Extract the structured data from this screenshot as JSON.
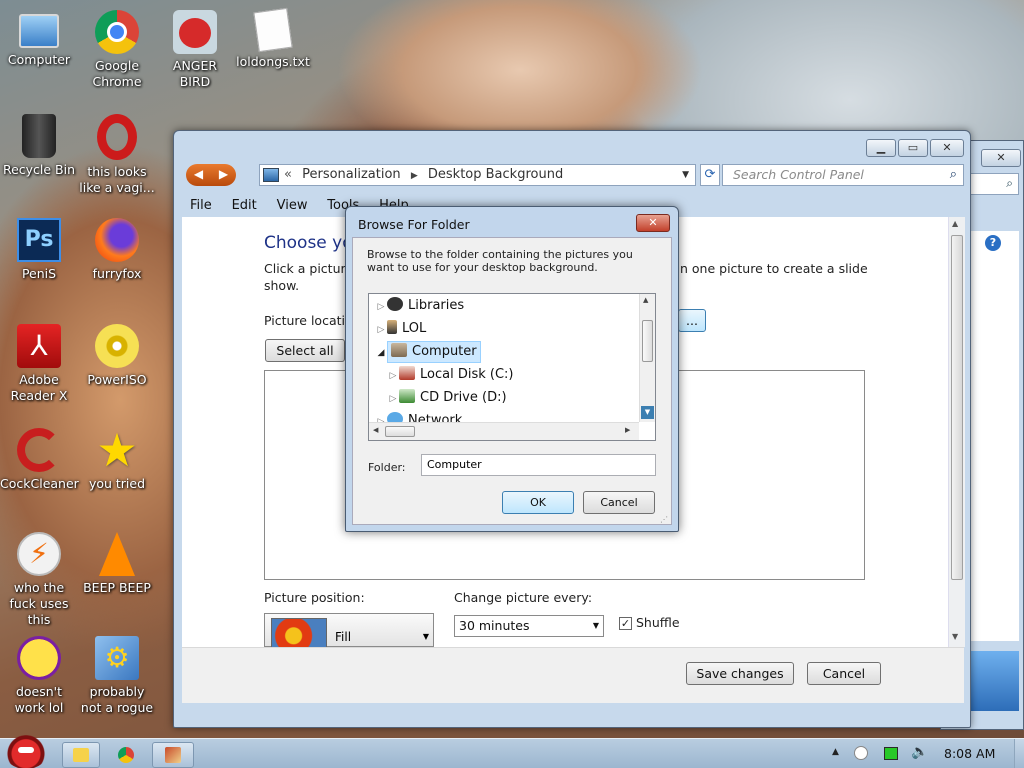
{
  "desktop": {
    "icons": [
      {
        "label": "Computer"
      },
      {
        "label": "Google Chrome"
      },
      {
        "label": "ANGER BIRD"
      },
      {
        "label": "loldongs.txt"
      },
      {
        "label": "Recycle Bin"
      },
      {
        "label": "this looks like a vagi..."
      },
      {
        "label": "PeniS"
      },
      {
        "label": "furryfox"
      },
      {
        "label": "Adobe Reader X"
      },
      {
        "label": "PowerISO"
      },
      {
        "label": "CockCleaner"
      },
      {
        "label": "you tried"
      },
      {
        "label": "who the fuck uses this"
      },
      {
        "label": "BEEP BEEP"
      },
      {
        "label": "doesn't work lol"
      },
      {
        "label": "probably not a rogue"
      }
    ]
  },
  "window": {
    "breadcrumb_prefix": "«",
    "breadcrumb": [
      "Personalization",
      "Desktop Background"
    ],
    "search_placeholder": "Search Control Panel",
    "menu": [
      "File",
      "Edit",
      "View",
      "Tools",
      "Help"
    ],
    "heading": "Choose you",
    "description_left": "Click a picture",
    "description_left2": "show.",
    "description_right": "n one picture to create a slide",
    "picture_location_label": "Picture locatio",
    "browse_button_label": "...",
    "select_all_label": "Select all",
    "picture_position_label": "Picture position:",
    "picture_position_value": "Fill",
    "change_picture_label": "Change picture every:",
    "change_picture_value": "30 minutes",
    "shuffle_label": "Shuffle",
    "shuffle_checked": true,
    "save_label": "Save changes",
    "cancel_label": "Cancel"
  },
  "dialog": {
    "title": "Browse For Folder",
    "instruction": "Browse to the folder containing the pictures you want to use for your desktop background.",
    "tree": [
      {
        "label": "Libraries",
        "level": 0
      },
      {
        "label": "LOL",
        "level": 0
      },
      {
        "label": "Computer",
        "level": 0,
        "selected": true
      },
      {
        "label": "Local Disk (C:)",
        "level": 1
      },
      {
        "label": "CD Drive (D:)",
        "level": 1
      },
      {
        "label": "Network",
        "level": 0
      }
    ],
    "folder_label": "Folder:",
    "folder_value": "Computer",
    "ok_label": "OK",
    "cancel_label": "Cancel"
  },
  "taskbar": {
    "clock": "8:08 AM"
  },
  "colors": {
    "accent": "#3f7fc1",
    "heading": "#1e3287",
    "selection": "#cce8ff"
  }
}
